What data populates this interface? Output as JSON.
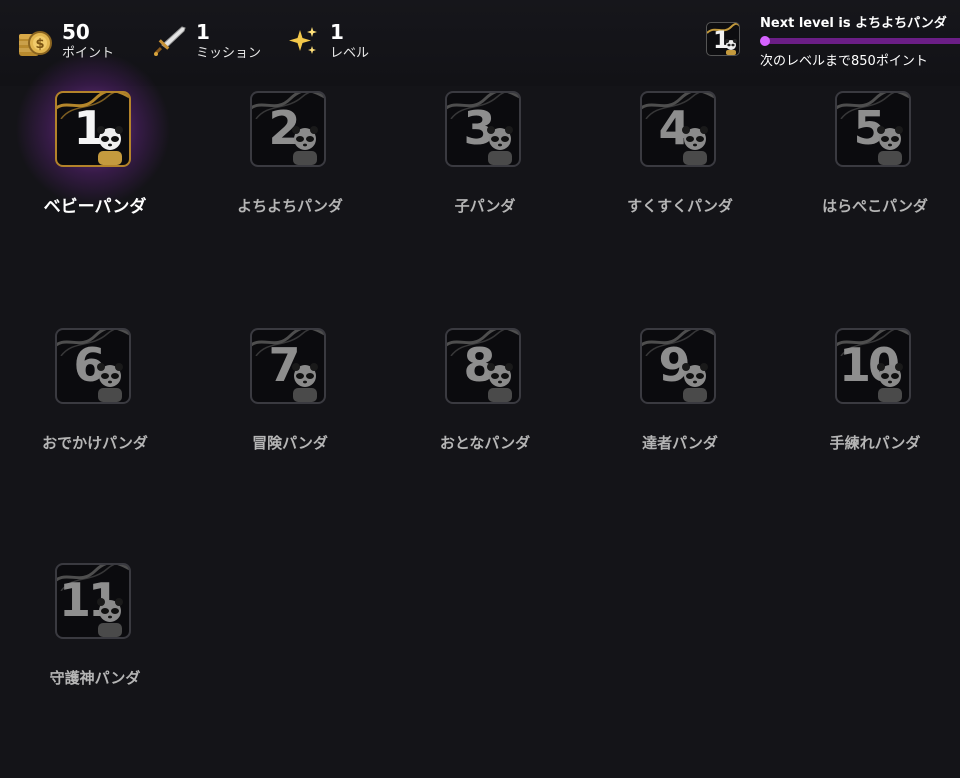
{
  "header": {
    "points": {
      "value": "50",
      "label": "ポイント",
      "icon": "coin-stack-icon"
    },
    "missions": {
      "value": "1",
      "label": "ミッション",
      "icon": "sword-icon"
    },
    "level": {
      "value": "1",
      "label": "レベル",
      "icon": "sparkles-icon"
    },
    "next_level": {
      "badge_number": "1",
      "title": "Next level is よちよちパンダ",
      "progress": 0.0,
      "subtitle": "次のレベルまで850ポイント"
    }
  },
  "levels": [
    {
      "number": "1",
      "name": "ベビーパンダ",
      "unlocked": true
    },
    {
      "number": "2",
      "name": "よちよちパンダ",
      "unlocked": false
    },
    {
      "number": "3",
      "name": "子パンダ",
      "unlocked": false
    },
    {
      "number": "4",
      "name": "すくすくパンダ",
      "unlocked": false
    },
    {
      "number": "5",
      "name": "はらぺこパンダ",
      "unlocked": false
    },
    {
      "number": "6",
      "name": "おでかけパンダ",
      "unlocked": false
    },
    {
      "number": "7",
      "name": "冒険パンダ",
      "unlocked": false
    },
    {
      "number": "8",
      "name": "おとなパンダ",
      "unlocked": false
    },
    {
      "number": "9",
      "name": "達者パンダ",
      "unlocked": false
    },
    {
      "number": "10",
      "name": "手練れパンダ",
      "unlocked": false
    },
    {
      "number": "11",
      "name": "守護神パンダ",
      "unlocked": false
    }
  ],
  "colors": {
    "background": "#141418",
    "accent": "#d563ff",
    "progress_track": "#6b1e86",
    "gold": "#b3832a"
  }
}
